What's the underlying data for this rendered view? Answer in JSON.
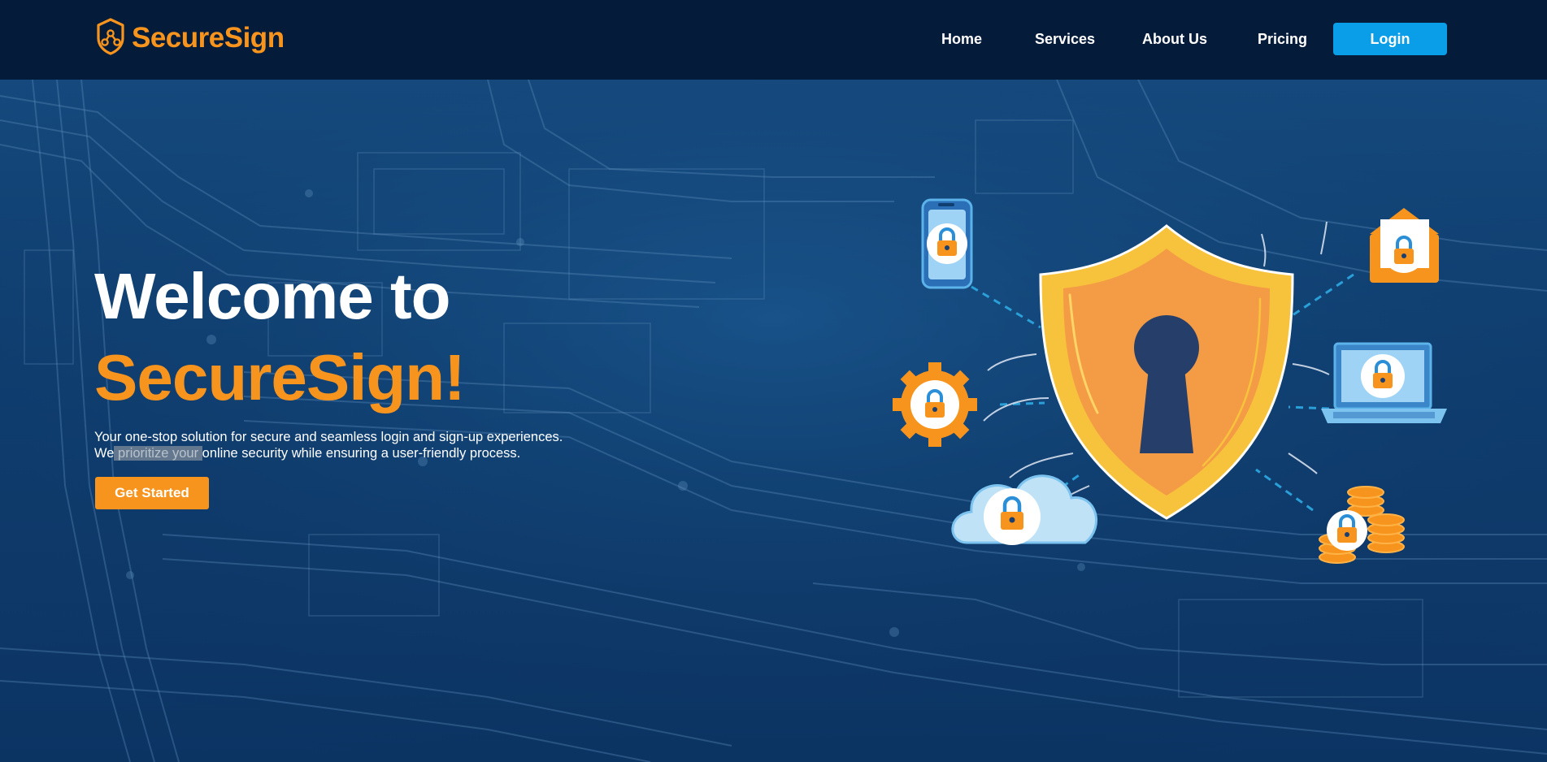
{
  "brand": {
    "name": "SecureSign",
    "logo_icon": "shield-network-icon",
    "color": "#f7941d"
  },
  "nav": {
    "links": [
      "Home",
      "Services",
      "About Us",
      "Pricing"
    ],
    "login_label": "Login",
    "login_color": "#0a9ee8"
  },
  "hero": {
    "title_line1": "Welcome to",
    "title_line2": "SecureSign!",
    "subtitle_line1": "Your one-stop solution for secure and seamless login and sign-up experiences.",
    "subtitle_line2_pre": "We",
    "subtitle_line2_highlight": " prioritize your ",
    "subtitle_line2_post": "online security while ensuring a user-friendly process.",
    "cta_label": "Get Started",
    "accent_color": "#f7941d",
    "background": "circuit-board"
  },
  "illustration": {
    "center": "shield-keyhole-icon",
    "satellites": [
      "phone-lock-icon",
      "envelope-lock-icon",
      "gear-lock-icon",
      "laptop-lock-icon",
      "cloud-lock-icon",
      "coins-lock-icon"
    ]
  }
}
